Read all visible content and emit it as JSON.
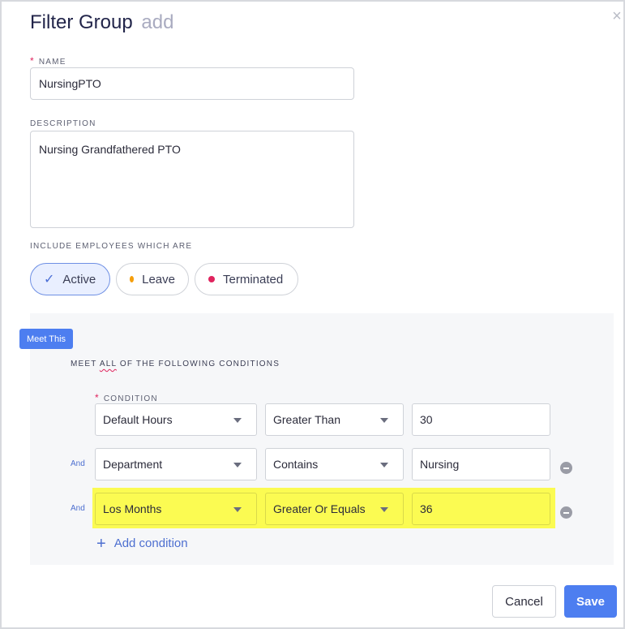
{
  "modal": {
    "title": "Filter Group",
    "subtitle": "add",
    "close_icon": "close-icon"
  },
  "name_field": {
    "label": "NAME",
    "required_mark": "*",
    "value": "NursingPTO"
  },
  "description_field": {
    "label": "DESCRIPTION",
    "value": "Nursing Grandfathered PTO"
  },
  "include": {
    "label": "INCLUDE EMPLOYEES WHICH ARE",
    "options": [
      {
        "label": "Active",
        "selected": true,
        "icon": "check-icon"
      },
      {
        "label": "Leave",
        "selected": false,
        "dot_color": "#f59e0b"
      },
      {
        "label": "Terminated",
        "selected": false,
        "dot_color": "#e0245e"
      }
    ]
  },
  "conditions": {
    "badge": "Meet This",
    "meet_prefix": "MEET ",
    "meet_quantifier": "ALL",
    "meet_suffix": " OF THE FOLLOWING CONDITIONS",
    "condition_label": "CONDITION",
    "required_mark": "*",
    "rows": [
      {
        "connector": "",
        "field": "Default Hours",
        "operator": "Greater Than",
        "value": "30"
      },
      {
        "connector": "And",
        "field": "Department",
        "operator": "Contains",
        "value": "Nursing"
      },
      {
        "connector": "And",
        "field": "Los Months",
        "operator": "Greater Or Equals",
        "value": "36"
      }
    ],
    "add_label": "Add condition"
  },
  "footer": {
    "cancel_label": "Cancel",
    "save_label": "Save"
  },
  "colors": {
    "accent": "#4d7ef0",
    "highlight": "#fbfb52",
    "required": "#e0245e"
  }
}
